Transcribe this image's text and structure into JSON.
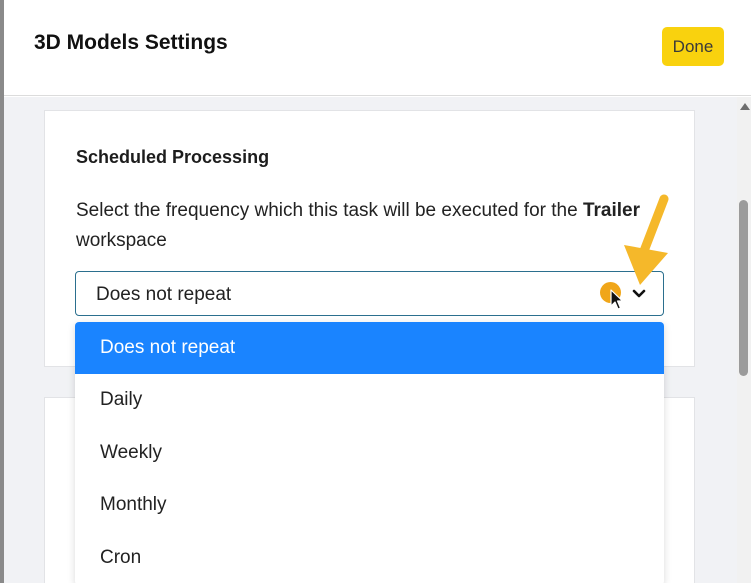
{
  "header": {
    "title": "3D Models Settings",
    "done_label": "Done"
  },
  "card": {
    "title": "Scheduled Processing",
    "description_prefix": "Select the frequency which this task will be executed for the",
    "workspace_name": "Trailer",
    "description_suffix": "workspace"
  },
  "frequency_select": {
    "value": "Does not repeat",
    "options": [
      "Does not repeat",
      "Daily",
      "Weekly",
      "Monthly",
      "Cron"
    ],
    "selected_index": 0
  },
  "colors": {
    "accent": "#f9d20e",
    "highlight": "#1a84ff",
    "select_border": "#2b6f8e",
    "annotation_arrow": "#f5b82a"
  },
  "icons": [
    "chevron-down-icon",
    "mouse-cursor-icon",
    "annotation-arrow-icon",
    "scroll-up-icon"
  ]
}
